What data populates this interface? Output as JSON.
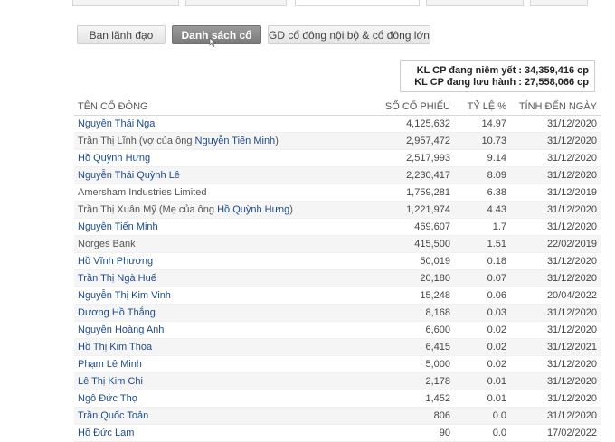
{
  "summary": {
    "listed_label": "KL CP đang niêm yết :",
    "listed_value": "34,359,416 cp",
    "outstanding_label": "KL CP đang lưu hành :",
    "outstanding_value": "27,558,066 cp"
  },
  "sub_tabs": [
    {
      "label": "Ban lãnh đạo"
    },
    {
      "label": "Danh sách cổ"
    },
    {
      "label": "GD cổ đông nội bộ & cổ đông lớn"
    }
  ],
  "table": {
    "headers": {
      "name": "TÊN CỔ ĐÔNG",
      "shares": "SỐ CỔ PHIẾU",
      "ratio": "TỶ LỆ %",
      "as_of": "TÍNH ĐẾN NGÀY"
    },
    "rows": [
      {
        "name": "Nguyễn Thái Nga",
        "shares": "4,125,632",
        "ratio": "14.97",
        "date": "31/12/2020"
      },
      {
        "name_pre": "Trần Thị Lĩnh (vợ của ông ",
        "name_link": "Nguyễn Tiến Minh",
        "name_post": ")",
        "shares": "2,957,472",
        "ratio": "10.73",
        "date": "31/12/2020"
      },
      {
        "name": "Hồ Quỳnh Hưng",
        "shares": "2,517,993",
        "ratio": "9.14",
        "date": "31/12/2020"
      },
      {
        "name": "Nguyễn Thái Quỳnh Lê",
        "shares": "2,230,417",
        "ratio": "8.09",
        "date": "31/12/2020"
      },
      {
        "name": "Amersham Industries Limited",
        "shares": "1,759,281",
        "ratio": "6.38",
        "date": "31/12/2019"
      },
      {
        "name_pre": "Trần Thị Xuân Mỹ (Mẹ của ông ",
        "name_link": "Hồ Quỳnh Hưng",
        "name_post": ")",
        "shares": "1,221,974",
        "ratio": "4.43",
        "date": "31/12/2020"
      },
      {
        "name": "Nguyễn Tiến Minh",
        "shares": "469,607",
        "ratio": "1.7",
        "date": "31/12/2020"
      },
      {
        "name": "Norges Bank",
        "shares": "415,500",
        "ratio": "1.51",
        "date": "22/02/2019"
      },
      {
        "name": "Hồ Vĩnh Phương",
        "shares": "50,019",
        "ratio": "0.18",
        "date": "31/12/2020"
      },
      {
        "name": "Trần Thị Ngà Huế",
        "shares": "20,180",
        "ratio": "0.07",
        "date": "31/12/2020"
      },
      {
        "name": "Nguyễn Thị Kim Vinh",
        "shares": "15,248",
        "ratio": "0.06",
        "date": "20/04/2022"
      },
      {
        "name": "Dương Hồ Thắng",
        "shares": "8,168",
        "ratio": "0.03",
        "date": "31/12/2020"
      },
      {
        "name": "Nguyễn Hoàng Anh",
        "shares": "6,600",
        "ratio": "0.02",
        "date": "31/12/2020"
      },
      {
        "name": "Hồ Thị Kim Thoa",
        "shares": "6,415",
        "ratio": "0.02",
        "date": "31/12/2021"
      },
      {
        "name": "Phạm Lê Minh",
        "shares": "5,000",
        "ratio": "0.02",
        "date": "31/12/2020"
      },
      {
        "name": "Lê Thị Kim Chi",
        "shares": "2,178",
        "ratio": "0.01",
        "date": "31/12/2020"
      },
      {
        "name": "Ngô Đức Thọ",
        "shares": "1,452",
        "ratio": "0.01",
        "date": "31/12/2020"
      },
      {
        "name": "Trần Quốc Toản",
        "shares": "806",
        "ratio": "0.0",
        "date": "31/12/2020"
      },
      {
        "name": "Hồ Đức Lam",
        "shares": "90",
        "ratio": "0.0",
        "date": "17/02/2022"
      }
    ]
  },
  "colors": {
    "link": "#1c4a8a",
    "active_tab_bg": "#8a8a8a",
    "top_tab_active_text": "#c8102e"
  }
}
